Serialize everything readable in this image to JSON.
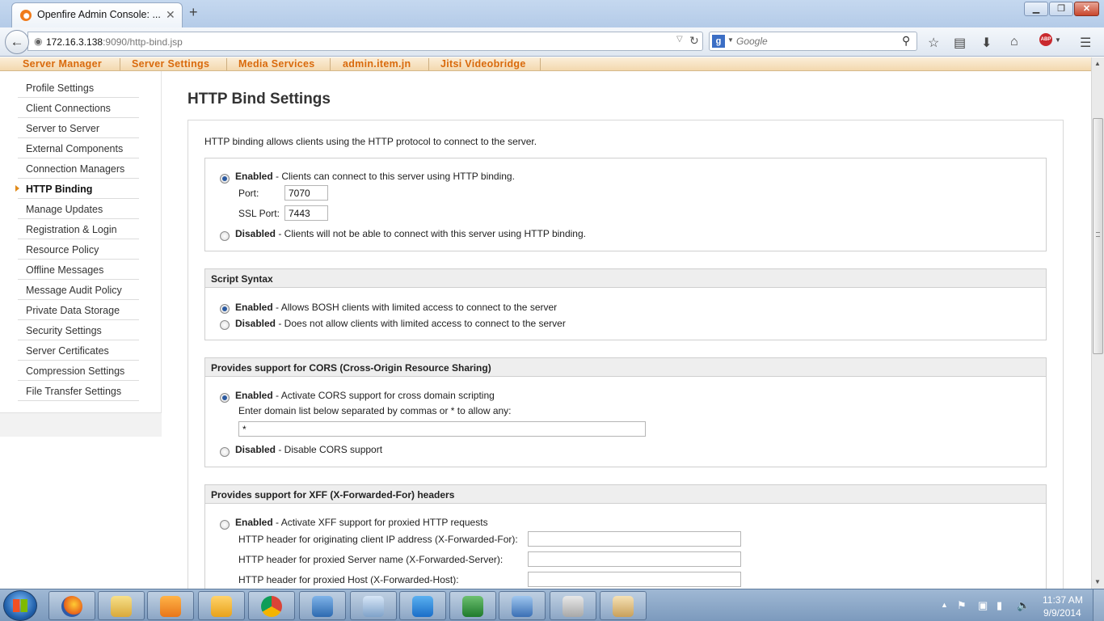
{
  "browser": {
    "tab_title": "Openfire Admin Console: ...",
    "tab_close": "✕",
    "new_tab": "+",
    "url_host": "172.16.3.138",
    "url_rest": ":9090/http-bind.jsp",
    "search_placeholder": "Google",
    "window_min": "▁",
    "window_max": "❐",
    "window_close": "✕"
  },
  "top_tabs": [
    {
      "label": "Server Manager"
    },
    {
      "label": "Server Settings"
    },
    {
      "label": "Media Services"
    },
    {
      "label": "admin.item.jn"
    },
    {
      "label": "Jitsi Videobridge"
    }
  ],
  "sidebar": {
    "items": [
      {
        "label": "Profile Settings"
      },
      {
        "label": "Client Connections"
      },
      {
        "label": "Server to Server"
      },
      {
        "label": "External Components"
      },
      {
        "label": "Connection Managers"
      },
      {
        "label": "HTTP Binding"
      },
      {
        "label": "Manage Updates"
      },
      {
        "label": "Registration & Login"
      },
      {
        "label": "Resource Policy"
      },
      {
        "label": "Offline Messages"
      },
      {
        "label": "Message Audit Policy"
      },
      {
        "label": "Private Data Storage"
      },
      {
        "label": "Security Settings"
      },
      {
        "label": "Server Certificates"
      },
      {
        "label": "Compression Settings"
      },
      {
        "label": "File Transfer Settings"
      }
    ],
    "active_index": 5
  },
  "page": {
    "title": "HTTP Bind Settings",
    "intro": "HTTP binding allows clients using the HTTP protocol to connect to the server."
  },
  "binding": {
    "enabled_label": "Enabled",
    "enabled_desc": " - Clients can connect to this server using HTTP binding.",
    "port_label": "Port:",
    "port_value": "7070",
    "ssl_port_label": "SSL Port:",
    "ssl_port_value": "7443",
    "disabled_label": "Disabled",
    "disabled_desc": " - Clients will not be able to connect with this server using HTTP binding."
  },
  "script_syntax": {
    "header": "Script Syntax",
    "enabled_label": "Enabled",
    "enabled_desc": " - Allows BOSH clients with limited access to connect to the server",
    "disabled_label": "Disabled",
    "disabled_desc": " - Does not allow clients with limited access to connect to the server"
  },
  "cors": {
    "header": "Provides support for CORS (Cross-Origin Resource Sharing)",
    "enabled_label": "Enabled",
    "enabled_desc": " - Activate CORS support for cross domain scripting",
    "domain_hint": "Enter domain list below separated by commas or * to allow any:",
    "domain_value": "*",
    "disabled_label": "Disabled",
    "disabled_desc": " - Disable CORS support"
  },
  "xff": {
    "header": "Provides support for XFF (X-Forwarded-For) headers",
    "enabled_label": "Enabled",
    "enabled_desc": " - Activate XFF support for proxied HTTP requests",
    "client_ip_label": "HTTP header for originating client IP address (X-Forwarded-For):",
    "client_ip_value": "",
    "server_label": "HTTP header for proxied Server name (X-Forwarded-Server):",
    "server_value": "",
    "host_label": "HTTP header for proxied Host (X-Forwarded-Host):",
    "host_value": ""
  },
  "taskbar": {
    "clock_time": "11:37 AM",
    "clock_date": "9/9/2014"
  },
  "colors": {
    "accent_orange": "#d96a0c",
    "radio_selected": "#2b5aa0"
  }
}
